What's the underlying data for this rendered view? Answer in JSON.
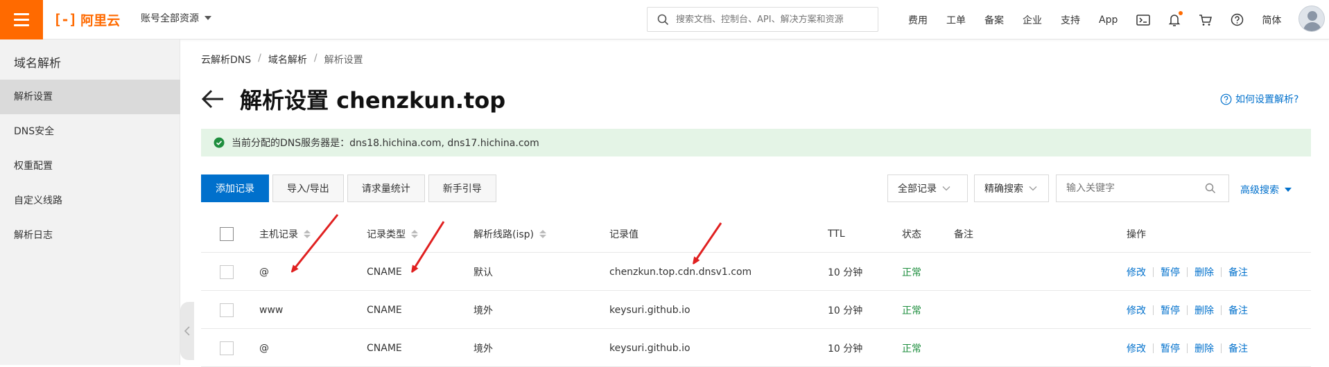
{
  "topbar": {
    "logo_text": "阿里云",
    "account": "账号全部资源",
    "search_placeholder": "搜索文档、控制台、API、解决方案和资源",
    "nav": [
      "费用",
      "工单",
      "备案",
      "企业",
      "支持",
      "App"
    ],
    "language": "简体",
    "icons": [
      "terminal-icon",
      "bell-icon",
      "cart-icon",
      "help-icon"
    ]
  },
  "sidebar": {
    "title": "域名解析",
    "items": [
      "解析设置",
      "DNS安全",
      "权重配置",
      "自定义线路",
      "解析日志"
    ],
    "active_index": 0
  },
  "breadcrumb": [
    "云解析DNS",
    "域名解析",
    "解析设置"
  ],
  "page": {
    "title": "解析设置 chenzkun.top",
    "help_link": "如何设置解析?"
  },
  "notice": {
    "text": "当前分配的DNS服务器是：dns18.hichina.com, dns17.hichina.com",
    "color": "#1e8e3e"
  },
  "toolbar": {
    "add": "添加记录",
    "import_export": "导入/导出",
    "stats": "请求量统计",
    "guide": "新手引导",
    "record_filter": "全部记录",
    "search_mode": "精确搜索",
    "keyword_placeholder": "输入关键字",
    "advanced": "高级搜索"
  },
  "table": {
    "columns": {
      "host": "主机记录",
      "type": "记录类型",
      "line": "解析线路(isp)",
      "value": "记录值",
      "ttl": "TTL",
      "status": "状态",
      "remark": "备注",
      "ops": "操作"
    },
    "rows": [
      {
        "host": "@",
        "type": "CNAME",
        "line": "默认",
        "value": "chenzkun.top.cdn.dnsv1.com",
        "ttl": "10 分钟",
        "status": "正常",
        "remark": ""
      },
      {
        "host": "www",
        "type": "CNAME",
        "line": "境外",
        "value": "keysuri.github.io",
        "ttl": "10 分钟",
        "status": "正常",
        "remark": ""
      },
      {
        "host": "@",
        "type": "CNAME",
        "line": "境外",
        "value": "keysuri.github.io",
        "ttl": "10 分钟",
        "status": "正常",
        "remark": ""
      }
    ],
    "row_actions": [
      "修改",
      "暂停",
      "删除",
      "备注"
    ]
  },
  "colors": {
    "brand": "#ff6a00",
    "primary": "#0070cc",
    "notice_bg": "#e4f4e6",
    "annotation": "#e02020"
  }
}
